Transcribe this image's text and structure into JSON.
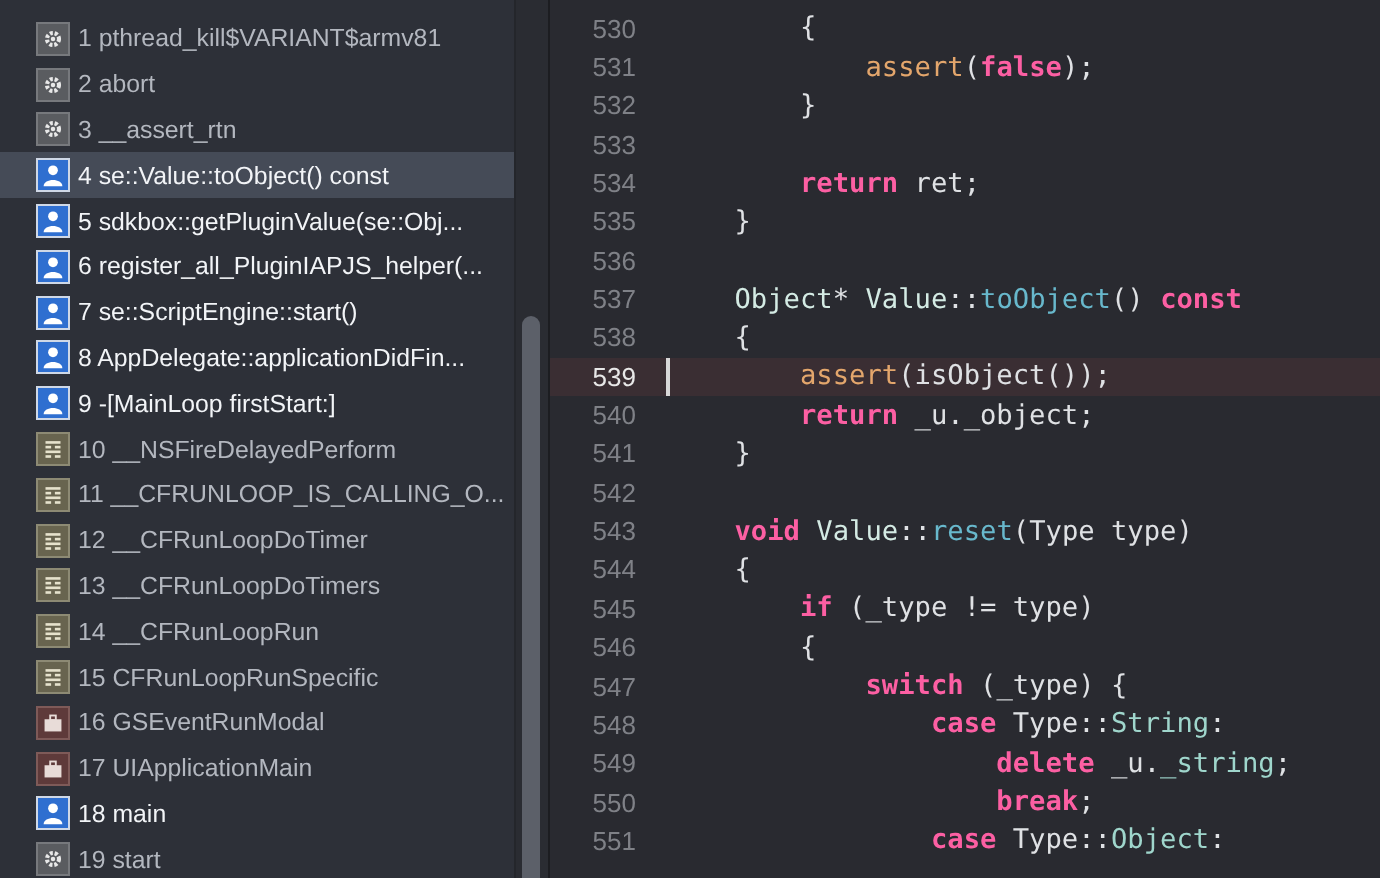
{
  "stack_frames": [
    {
      "kind": "system",
      "label": "1 pthread_kill$VARIANT$armv81",
      "selected": false
    },
    {
      "kind": "system",
      "label": "2 abort",
      "selected": false
    },
    {
      "kind": "system",
      "label": "3 __assert_rtn",
      "selected": false
    },
    {
      "kind": "user",
      "label": "4 se::Value::toObject() const",
      "selected": true
    },
    {
      "kind": "user",
      "label": "5 sdkbox::getPluginValue(se::Obj...",
      "selected": false
    },
    {
      "kind": "user",
      "label": "6 register_all_PluginIAPJS_helper(...",
      "selected": false
    },
    {
      "kind": "user",
      "label": "7 se::ScriptEngine::start()",
      "selected": false
    },
    {
      "kind": "user",
      "label": "8 AppDelegate::applicationDidFin...",
      "selected": false
    },
    {
      "kind": "user",
      "label": "9 -[MainLoop firstStart:]",
      "selected": false
    },
    {
      "kind": "framework",
      "label": "10 __NSFireDelayedPerform",
      "selected": false
    },
    {
      "kind": "framework",
      "label": "11 __CFRUNLOOP_IS_CALLING_O...",
      "selected": false
    },
    {
      "kind": "framework",
      "label": "12 __CFRunLoopDoTimer",
      "selected": false
    },
    {
      "kind": "framework",
      "label": "13 __CFRunLoopDoTimers",
      "selected": false
    },
    {
      "kind": "framework",
      "label": "14 __CFRunLoopRun",
      "selected": false
    },
    {
      "kind": "framework",
      "label": "15 CFRunLoopRunSpecific",
      "selected": false
    },
    {
      "kind": "app",
      "label": "16 GSEventRunModal",
      "selected": false
    },
    {
      "kind": "app",
      "label": "17 UIApplicationMain",
      "selected": false
    },
    {
      "kind": "user",
      "label": "18 main",
      "selected": false
    },
    {
      "kind": "system",
      "label": "19 start",
      "selected": false
    }
  ],
  "editor": {
    "lines": [
      {
        "number": "530",
        "current": false,
        "tokens": [
          {
            "kind": "plain",
            "text": "        {"
          }
        ]
      },
      {
        "number": "531",
        "current": false,
        "tokens": [
          {
            "kind": "call",
            "text": "            assert"
          },
          {
            "kind": "plain",
            "text": "("
          },
          {
            "kind": "keyword",
            "text": "false"
          },
          {
            "kind": "plain",
            "text": ");"
          }
        ]
      },
      {
        "number": "532",
        "current": false,
        "tokens": [
          {
            "kind": "plain",
            "text": "        }"
          }
        ]
      },
      {
        "number": "533",
        "current": false
      },
      {
        "number": "534",
        "current": false,
        "tokens": [
          {
            "kind": "keyword",
            "text": "        return"
          },
          {
            "kind": "plain",
            "text": " ret;"
          }
        ]
      },
      {
        "number": "535",
        "current": false,
        "tokens": [
          {
            "kind": "plain",
            "text": "    }"
          }
        ]
      },
      {
        "number": "536",
        "current": false
      },
      {
        "number": "537",
        "current": false,
        "tokens": [
          {
            "kind": "type",
            "text": "    Object"
          },
          {
            "kind": "plain",
            "text": "* "
          },
          {
            "kind": "type",
            "text": "Value"
          },
          {
            "kind": "plain",
            "text": "::"
          },
          {
            "kind": "method",
            "text": "toObject"
          },
          {
            "kind": "plain",
            "text": "() "
          },
          {
            "kind": "keyword",
            "text": "const"
          }
        ]
      },
      {
        "number": "538",
        "current": false,
        "tokens": [
          {
            "kind": "plain",
            "text": "    {"
          }
        ]
      },
      {
        "number": "539",
        "current": true,
        "tokens": [
          {
            "kind": "call",
            "text": "        assert"
          },
          {
            "kind": "plain",
            "text": "(isObject());"
          }
        ]
      },
      {
        "number": "540",
        "current": false,
        "tokens": [
          {
            "kind": "keyword",
            "text": "        return"
          },
          {
            "kind": "plain",
            "text": " _u._object;"
          }
        ]
      },
      {
        "number": "541",
        "current": false,
        "tokens": [
          {
            "kind": "plain",
            "text": "    }"
          }
        ]
      },
      {
        "number": "542",
        "current": false
      },
      {
        "number": "543",
        "current": false,
        "tokens": [
          {
            "kind": "keyword",
            "text": "    void"
          },
          {
            "kind": "type",
            "text": " Value"
          },
          {
            "kind": "plain",
            "text": "::"
          },
          {
            "kind": "method",
            "text": "reset"
          },
          {
            "kind": "plain",
            "text": "(Type type)"
          }
        ]
      },
      {
        "number": "544",
        "current": false,
        "tokens": [
          {
            "kind": "plain",
            "text": "    {"
          }
        ]
      },
      {
        "number": "545",
        "current": false,
        "tokens": [
          {
            "kind": "keyword",
            "text": "        if"
          },
          {
            "kind": "plain",
            "text": " (_type != type)"
          }
        ]
      },
      {
        "number": "546",
        "current": false,
        "tokens": [
          {
            "kind": "plain",
            "text": "        {"
          }
        ]
      },
      {
        "number": "547",
        "current": false,
        "tokens": [
          {
            "kind": "keyword",
            "text": "            switch"
          },
          {
            "kind": "plain",
            "text": " (_type) {"
          }
        ]
      },
      {
        "number": "548",
        "current": false,
        "tokens": [
          {
            "kind": "keyword",
            "text": "                case"
          },
          {
            "kind": "plain",
            "text": " Type::"
          },
          {
            "kind": "member",
            "text": "String"
          },
          {
            "kind": "plain",
            "text": ":"
          }
        ]
      },
      {
        "number": "549",
        "current": false,
        "tokens": [
          {
            "kind": "keyword",
            "text": "                    delete"
          },
          {
            "kind": "plain",
            "text": " _u."
          },
          {
            "kind": "member",
            "text": "_string"
          },
          {
            "kind": "plain",
            "text": ";"
          }
        ]
      },
      {
        "number": "550",
        "current": false,
        "tokens": [
          {
            "kind": "keyword",
            "text": "                    break"
          },
          {
            "kind": "plain",
            "text": ";"
          }
        ]
      },
      {
        "number": "551",
        "current": false,
        "tokens": [
          {
            "kind": "keyword",
            "text": "                case"
          },
          {
            "kind": "plain",
            "text": " Type::"
          },
          {
            "kind": "member",
            "text": "Object"
          },
          {
            "kind": "plain",
            "text": ":"
          }
        ]
      }
    ]
  }
}
